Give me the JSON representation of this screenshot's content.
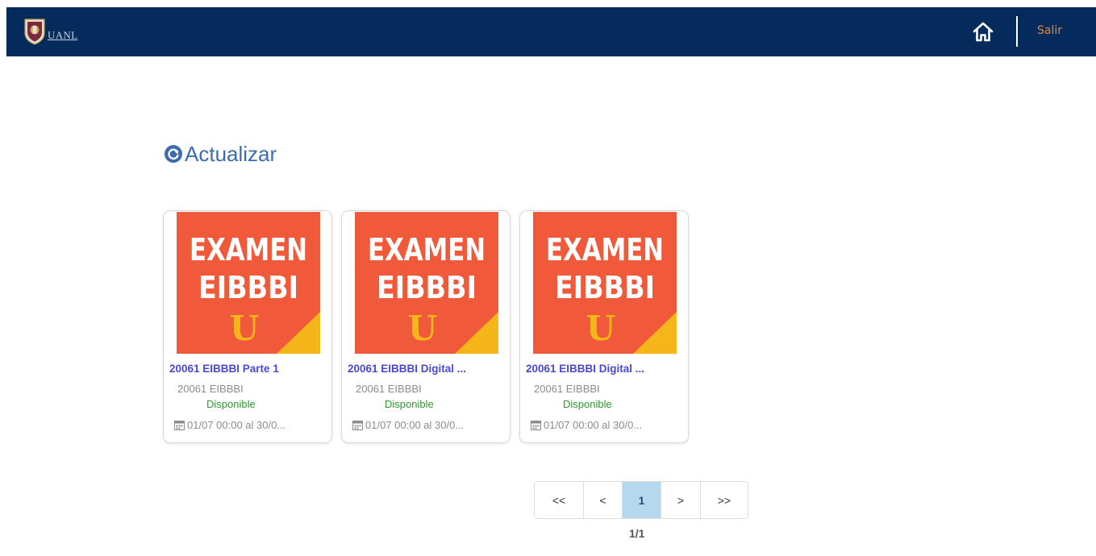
{
  "header": {
    "logo_text": "UANL",
    "logout_label": "Salir"
  },
  "refresh": {
    "label": "Actualizar"
  },
  "cards": [
    {
      "image_line1": "EXAMEN",
      "image_line2": "EIBBBI",
      "image_letter": "U",
      "title": "20061 EIBBBI Parte 1",
      "code": "20061 EIBBBI",
      "status": "Disponible",
      "date": "01/07 00:00 al 30/0..."
    },
    {
      "image_line1": "EXAMEN",
      "image_line2": "EIBBBI",
      "image_letter": "U",
      "title": "20061 EIBBBI Digital ...",
      "code": "20061 EIBBBI",
      "status": "Disponible",
      "date": "01/07 00:00 al 30/0..."
    },
    {
      "image_line1": "EXAMEN",
      "image_line2": "EIBBBI",
      "image_letter": "U",
      "title": "20061 EIBBBI Digital ...",
      "code": "20061 EIBBBI",
      "status": "Disponible",
      "date": "01/07 00:00 al 30/0..."
    }
  ],
  "pagination": {
    "first": "<<",
    "prev": "<",
    "current": "1",
    "next": ">",
    "last": ">>",
    "page_count": "1/1"
  },
  "colors": {
    "navbar": "#052b5d",
    "logout": "#e8872d",
    "refresh": "#3c6cb0",
    "card_image": "#f05a3a",
    "card_accent": "#f6b619",
    "title": "#4a47d6",
    "status": "#2a9d2a",
    "active_page": "#b5d8ef"
  },
  "icons": {
    "home": "home-icon",
    "refresh": "refresh-icon",
    "calendar": "calendar-icon",
    "seal": "university-seal"
  }
}
